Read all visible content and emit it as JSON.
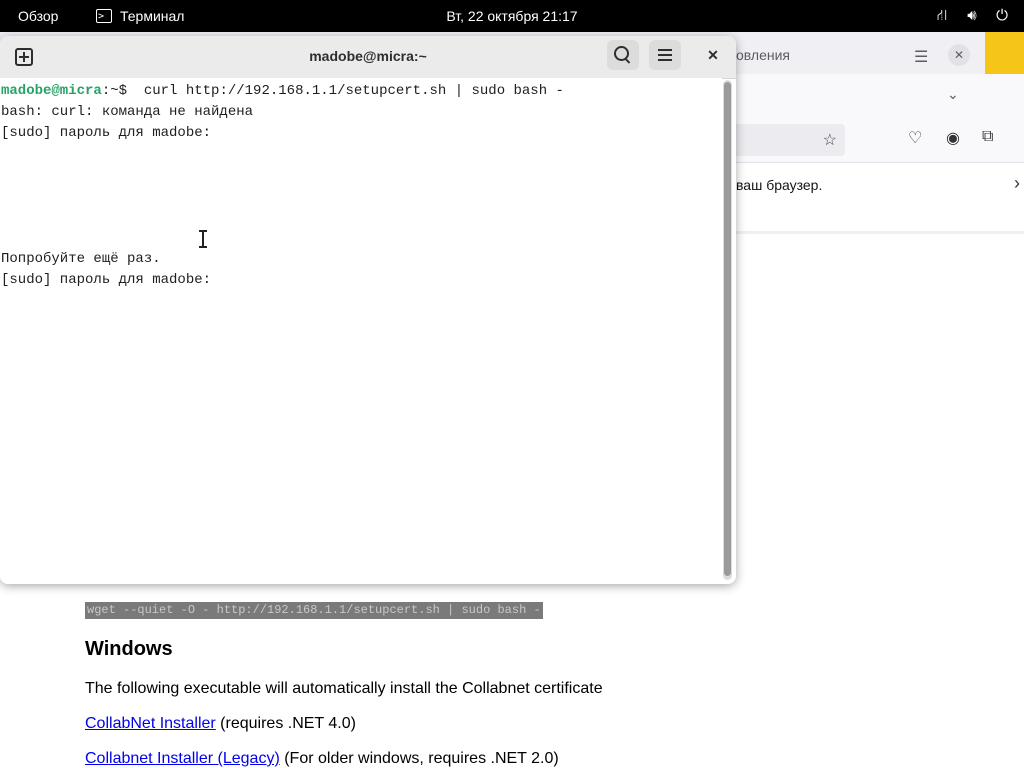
{
  "topbar": {
    "overview": "Обзор",
    "app_name": "Терминал",
    "clock": "Вт, 22 октября  21:17",
    "status_icons": [
      "network-icon",
      "volume-icon",
      "power-icon"
    ]
  },
  "browser": {
    "tab_title": "овления",
    "notice_text": "ваш браузер.",
    "code_line": "wget --quiet -O - http://192.168.1.1/setupcert.sh | sudo bash -",
    "heading": "Windows",
    "paragraph": "The following executable will automatically install the Collabnet certificate",
    "link1": "CollabNet Installer",
    "link1_suffix": " (requires .NET 4.0)",
    "link2": "Collabnet Installer (Legacy)",
    "link2_suffix": " (For older windows, requires .NET 2.0)"
  },
  "terminal": {
    "title": "madobe@micra:~",
    "prompt_user": "madobe@micra",
    "prompt_path": ":~$ ",
    "command": " curl http://192.168.1.1/setupcert.sh | sudo bash -",
    "lines": [
      "bash: curl: команда не найдена",
      "[sudo] пароль для madobe:",
      "Попробуйте ещё раз.",
      "[sudo] пароль для madobe:"
    ]
  }
}
